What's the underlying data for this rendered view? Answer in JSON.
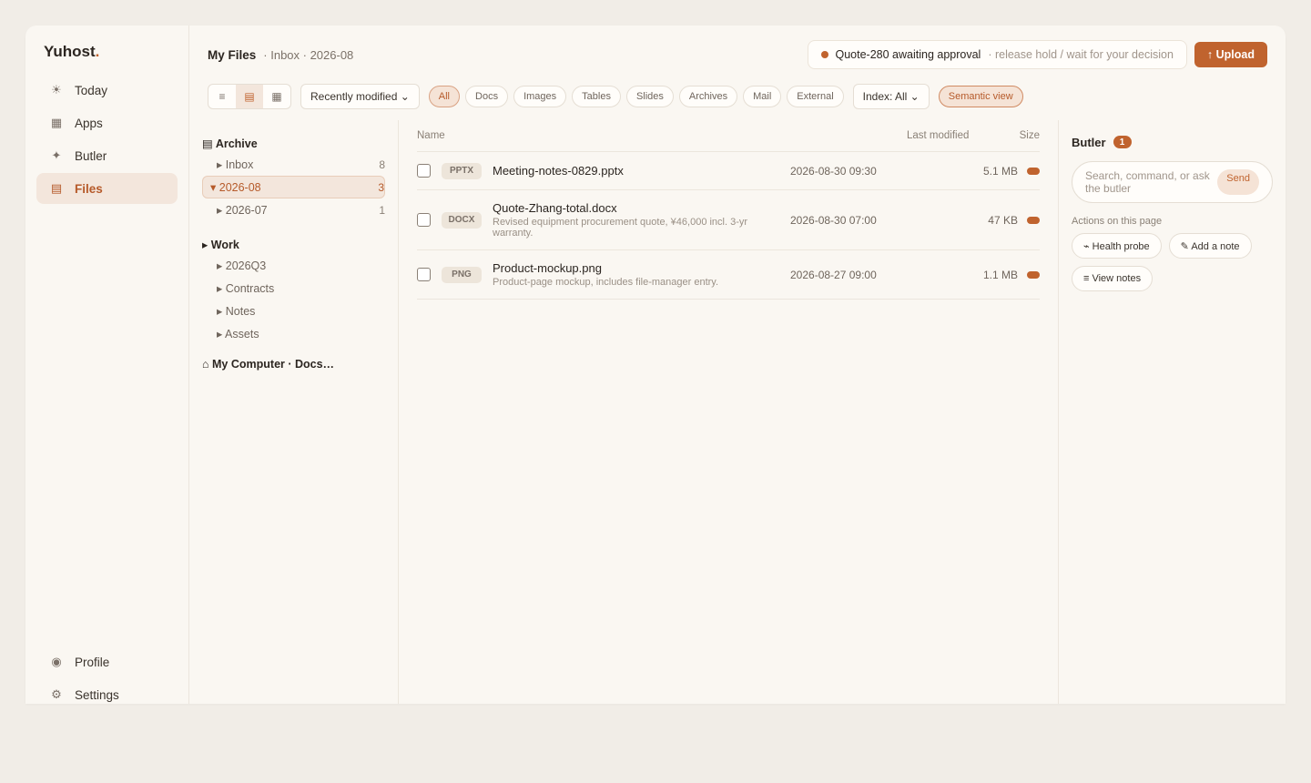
{
  "brand": {
    "name": "Yuhost",
    "dot": "."
  },
  "nav": {
    "items": [
      {
        "icon": "☀",
        "label": "Today"
      },
      {
        "icon": "▦",
        "label": "Apps"
      },
      {
        "icon": "✦",
        "label": "Butler"
      },
      {
        "icon": "▤",
        "label": "Files"
      }
    ],
    "bottom": [
      {
        "icon": "◉",
        "label": "Profile"
      },
      {
        "icon": "⚙",
        "label": "Settings"
      }
    ]
  },
  "header": {
    "title": "My Files",
    "crumb": "· Inbox · 2026-08",
    "approval": {
      "text": "Quote-280 awaiting approval",
      "hint": "· release hold / wait for your decision"
    },
    "upload_label": "↑ Upload"
  },
  "toolbar": {
    "view_icons": [
      "≡",
      "▤",
      "▦"
    ],
    "sort_label": "Recently modified ⌄",
    "chips": [
      "All",
      "Docs",
      "Images",
      "Tables",
      "Slides",
      "Archives",
      "Mail",
      "External"
    ],
    "index_label": "Index: All ⌄",
    "semantic_label": "Semantic view"
  },
  "tree": {
    "archive": {
      "label": "▤ Archive",
      "items": [
        {
          "label": "▸ Inbox",
          "count": "8"
        },
        {
          "label": "▾ 2026-08",
          "count": "3"
        },
        {
          "label": "▸ 2026-07",
          "count": "1"
        }
      ]
    },
    "work": {
      "label": "▸ Work",
      "items": [
        {
          "label": "▸ 2026Q3"
        },
        {
          "label": "▸ Contracts"
        },
        {
          "label": "▸ Notes"
        },
        {
          "label": "▸ Assets"
        }
      ]
    },
    "computer": {
      "label": "⌂ My Computer · Docs…"
    }
  },
  "files": {
    "columns": {
      "name": "Name",
      "modified": "Last modified",
      "size": "Size"
    },
    "rows": [
      {
        "type": "PPTX",
        "name": "Meeting-notes-0829.pptx",
        "desc": "",
        "modified": "2026-08-30 09:30",
        "size": "5.1 MB"
      },
      {
        "type": "DOCX",
        "name": "Quote-Zhang-total.docx",
        "desc": "Revised equipment procurement quote, ¥46,000 incl. 3-yr warranty.",
        "modified": "2026-08-30 07:00",
        "size": "47 KB"
      },
      {
        "type": "PNG",
        "name": "Product-mockup.png",
        "desc": "Product-page mockup, includes file-manager entry.",
        "modified": "2026-08-27 09:00",
        "size": "1.1 MB"
      }
    ]
  },
  "butler": {
    "title": "Butler",
    "count": "1",
    "placeholder": "Search, command, or ask the butler",
    "send_label": "Send",
    "actions_label": "Actions on this page",
    "actions": [
      "⌁ Health probe",
      "✎ Add a note",
      "≡ View notes"
    ]
  },
  "colors": {
    "accent": "#c0632e",
    "background": "#f1ede7",
    "panel": "#faf7f2"
  }
}
